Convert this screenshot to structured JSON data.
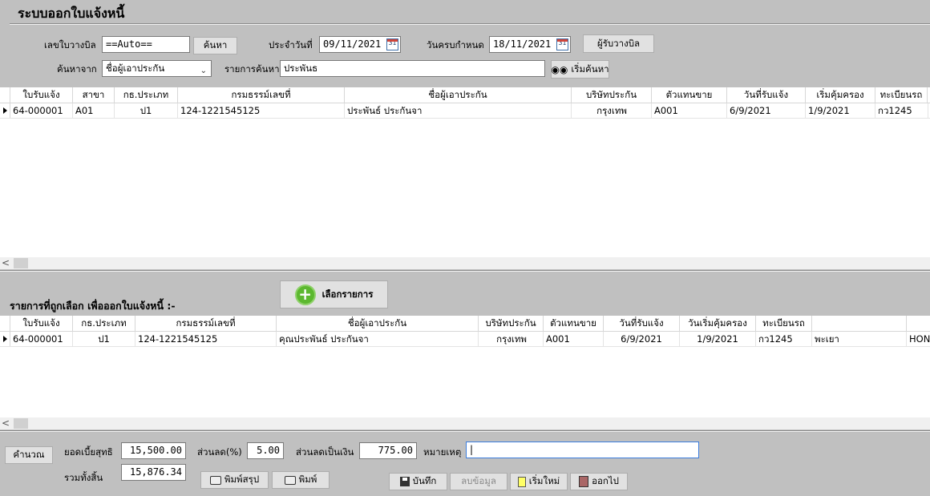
{
  "title": "ระบบออกใบแจ้งหนี้",
  "form": {
    "bill_no_label": "เลขใบวางบิล",
    "bill_no_value": "==Auto==",
    "search_button": "ค้นหา",
    "date_label": "ประจำวันที่",
    "date_value": "09/11/2021",
    "due_label": "วันครบกำหนด",
    "due_value": "18/11/2021",
    "receiver_button": "ผู้รับวางบิล",
    "search_from_label": "ค้นหาจาก",
    "search_from_value": "ชื่อผู้เอาประกัน",
    "search_text_label": "รายการค้นหา",
    "search_text_value": "ประพันธ",
    "start_search_button": "เริ่มค้นหา"
  },
  "top_grid": {
    "columns": [
      "ใบรับแจ้ง",
      "สาขา",
      "กธ.ประเภท",
      "กรมธรรม์เลขที่",
      "ชื่อผู้เอาประกัน",
      "บริษัทประกัน",
      "ตัวแทนขาย",
      "วันที่รับแจ้ง",
      "เริ่มคุ้มครอง",
      "ทะเบียนรถ"
    ],
    "rows": [
      [
        "64-000001",
        "A01",
        "ป1",
        "124-1221545125",
        "ประพันธ์ ประกันจา",
        "กรุงเทพ",
        "A001",
        "6/9/2021",
        "1/9/2021",
        "กว1245"
      ]
    ]
  },
  "section": {
    "selected_label": "รายการที่ถูกเลือก เพื่อออกใบแจ้งหนี้ :-",
    "select_button": "เลือกรายการ"
  },
  "bottom_grid": {
    "columns": [
      "ใบรับแจ้ง",
      "กธ.ประเภท",
      "กรมธรรม์เลขที่",
      "ชื่อผู้เอาประกัน",
      "บริษัทประกัน",
      "ตัวแทนขาย",
      "วันที่รับแจ้ง",
      "วันเริ่มคุ้มครอง",
      "ทะเบียนรถ",
      "",
      ""
    ],
    "rows": [
      [
        "64-000001",
        "ป1",
        "124-1221545125",
        "คุณประพันธ์ ประกันจา",
        "กรุงเทพ",
        "A001",
        "6/9/2021",
        "1/9/2021",
        "กว1245",
        "พะเยา",
        "HON"
      ]
    ]
  },
  "totals": {
    "calc_button": "คำนวณ",
    "net_label": "ยอดเบี้ยสุทธิ",
    "net_value": "15,500.00",
    "discount_pct_label": "ส่วนลด(%)",
    "discount_pct_value": "5.00",
    "discount_amt_label": "ส่วนลดเป็นเงิน",
    "discount_amt_value": "775.00",
    "note_label": "หมายเหตุ",
    "note_value": "",
    "total_label": "รวมทั้งสิ้น",
    "total_value": "15,876.34"
  },
  "actions": {
    "print_summary": "พิมพ์สรุป",
    "print": "พิมพ์",
    "save": "บันทึก",
    "delete": "ลบข้อมูล",
    "new": "เริ่มใหม่",
    "exit": "ออกไป"
  },
  "icons": {
    "calendar": "calendar-icon",
    "dropdown": "chevron-down-icon",
    "binoculars": "binoculars-icon",
    "plus": "plus-circle-icon",
    "printer": "printer-icon",
    "save": "floppy-disk-icon",
    "new": "new-document-icon",
    "exit": "exit-door-icon"
  },
  "colors": {
    "background": "#c0c0c0",
    "add_icon": "#5cb82f"
  }
}
